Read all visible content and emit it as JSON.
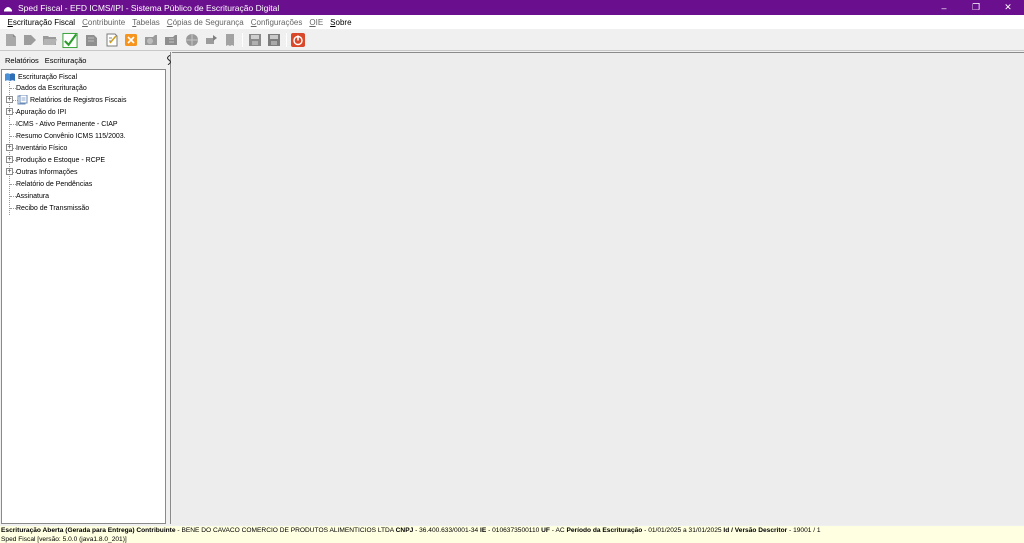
{
  "window": {
    "title": "Sped Fiscal - EFD ICMS/IPI - Sistema Público de Escrituração Digital",
    "minimize": "–",
    "restore": "❐",
    "close": "✕"
  },
  "menu": [
    {
      "label": "Escrituração Fiscal",
      "enabled": true
    },
    {
      "label": "Contribuinte",
      "enabled": false
    },
    {
      "label": "Tabelas",
      "enabled": false
    },
    {
      "label": "Cópias de Segurança",
      "enabled": false
    },
    {
      "label": "Configurações",
      "enabled": false
    },
    {
      "label": "OIE",
      "enabled": false
    },
    {
      "label": "Sobre",
      "enabled": true
    }
  ],
  "toolbar": {
    "buttons": [
      {
        "icon": "new-file-icon",
        "enabled": false
      },
      {
        "icon": "forward-arrow-icon",
        "enabled": false
      },
      {
        "icon": "open-folder-icon",
        "enabled": false
      },
      {
        "icon": "validate-check-icon",
        "enabled": true
      },
      {
        "icon": "sign-icon",
        "enabled": false
      },
      {
        "icon": "edit-document-icon",
        "enabled": true
      },
      {
        "icon": "close-icon",
        "enabled": true
      },
      {
        "icon": "import-icon",
        "enabled": false
      },
      {
        "icon": "export-icon",
        "enabled": false
      },
      {
        "icon": "globe-icon",
        "enabled": false
      },
      {
        "icon": "transmit-icon",
        "enabled": false
      },
      {
        "icon": "receipt-icon",
        "enabled": false
      },
      {
        "icon": "save-icon",
        "enabled": false
      },
      {
        "icon": "save-as-icon",
        "enabled": false
      },
      {
        "icon": "power-icon",
        "enabled": true
      }
    ],
    "accent_green": "#2e9d2e",
    "accent_orange": "#e8590c",
    "accent_red": "#c0392b"
  },
  "left_panel": {
    "tabs": [
      "Relatórios",
      "Escrituração"
    ],
    "tree": {
      "root": "Escrituração Fiscal",
      "items": [
        {
          "label": "Dados da Escrituração",
          "expandable": false
        },
        {
          "label": "Relatórios de Registros Fiscais",
          "expandable": true
        },
        {
          "label": "Apuração do IPI",
          "expandable": true
        },
        {
          "label": "ICMS - Ativo Permanente - CIAP",
          "expandable": false
        },
        {
          "label": "Resumo  Convênio ICMS 115/2003.",
          "expandable": false
        },
        {
          "label": "Inventário Físico",
          "expandable": true
        },
        {
          "label": "Produção e Estoque - RCPE",
          "expandable": true
        },
        {
          "label": "Outras Informações",
          "expandable": true
        },
        {
          "label": "Relatório de Pendências",
          "expandable": false
        },
        {
          "label": "Assinatura",
          "expandable": false
        },
        {
          "label": "Recibo de Transmissão",
          "expandable": false
        }
      ]
    }
  },
  "status": {
    "line1": {
      "status_label": "Escrituração Aberta (Gerada para Entrega)",
      "contribuinte_label": "Contribuinte",
      "contribuinte_value": "BENE DO CAVACO COMERCIO DE PRODUTOS ALIMENTICIOS LTDA",
      "cnpj_label": "CNPJ",
      "cnpj_value": "36.400.633/0001-34",
      "ie_label": "IE",
      "ie_value": "0106373500110",
      "uf_label": "UF",
      "uf_value": "AC",
      "periodo_label": "Período da Escrituração",
      "periodo_value": "01/01/2025 a 31/01/2025",
      "versao_label": "Id / Versão Descritor",
      "versao_value": "19001 / 1"
    },
    "line2": "Sped Fiscal [versão: 5.0.0 (java1.8.0_201)]",
    "background": "#ffffe1"
  }
}
